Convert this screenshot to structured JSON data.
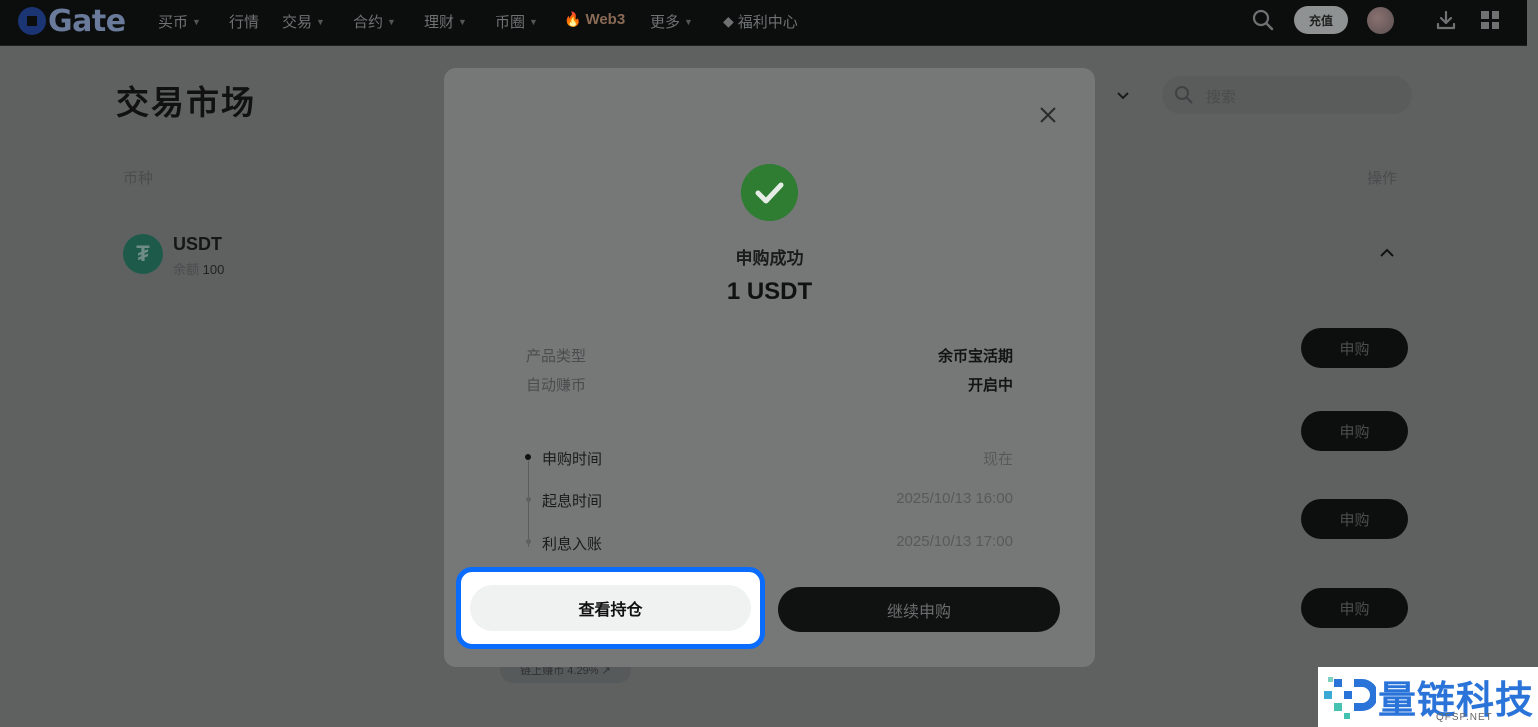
{
  "nav": {
    "logo": "Gate",
    "items": [
      {
        "label": "买币",
        "caret": true
      },
      {
        "label": "行情",
        "caret": false
      },
      {
        "label": "交易",
        "caret": true
      },
      {
        "label": "合约",
        "caret": true
      },
      {
        "label": "理财",
        "caret": true
      },
      {
        "label": "币圈",
        "caret": true
      },
      {
        "label": "Web3",
        "caret": false
      },
      {
        "label": "更多",
        "caret": true
      },
      {
        "label": "福利中心",
        "caret": false
      }
    ],
    "deposit": "充值"
  },
  "page": {
    "title": "交易市场",
    "col_coin": "币种",
    "col_op": "操作",
    "search_placeholder": "搜索",
    "asset": {
      "symbol": "USDT",
      "balance_label": "余额",
      "balance_value": "100"
    },
    "subscribe_label": "申购",
    "chain_link": "链上赚币 4.29% ↗"
  },
  "modal": {
    "status": "申购成功",
    "amount": "1 USDT",
    "details": [
      {
        "label": "产品类型",
        "value": "余币宝活期"
      },
      {
        "label": "自动赚币",
        "value": "开启中"
      }
    ],
    "timeline": [
      {
        "label": "申购时间",
        "value": "现在"
      },
      {
        "label": "起息时间",
        "value": "2025/10/13 16:00"
      },
      {
        "label": "利息入账",
        "value": "2025/10/13 17:00"
      }
    ],
    "view_position": "查看持仓",
    "continue": "继续申购"
  },
  "watermark": {
    "text": "量链科技",
    "sub": "QFSP.NET"
  },
  "colors": {
    "highlight": "#0a6cff",
    "success": "#2e7d32"
  }
}
